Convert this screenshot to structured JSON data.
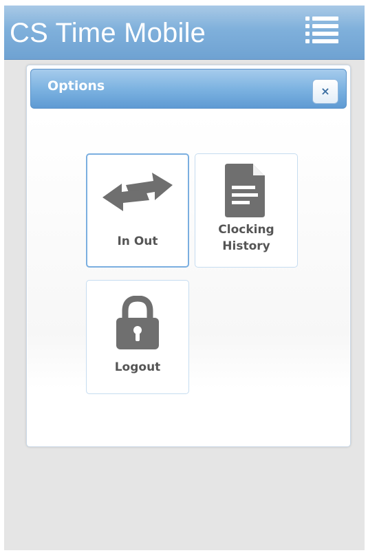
{
  "header": {
    "app_title": "CS Time Mobile",
    "menu_icon": "list-menu-icon"
  },
  "dialog": {
    "title": "Options",
    "close_label": "×",
    "close_icon": "close-icon"
  },
  "tiles": [
    {
      "id": "in-out",
      "label": "In Out",
      "icon": "swap-arrows-icon",
      "active": true
    },
    {
      "id": "clocking-history",
      "label_line1": "Clocking",
      "label_line2": "History",
      "icon": "document-icon",
      "active": false
    },
    {
      "id": "logout",
      "label": "Logout",
      "icon": "padlock-icon",
      "active": false
    }
  ],
  "colors": {
    "header_blue": "#7fb0db",
    "dialog_header_blue": "#7db3e1",
    "icon_gray": "#6f6f6f",
    "label_gray": "#555555",
    "background_gray": "#e5e5e5"
  }
}
